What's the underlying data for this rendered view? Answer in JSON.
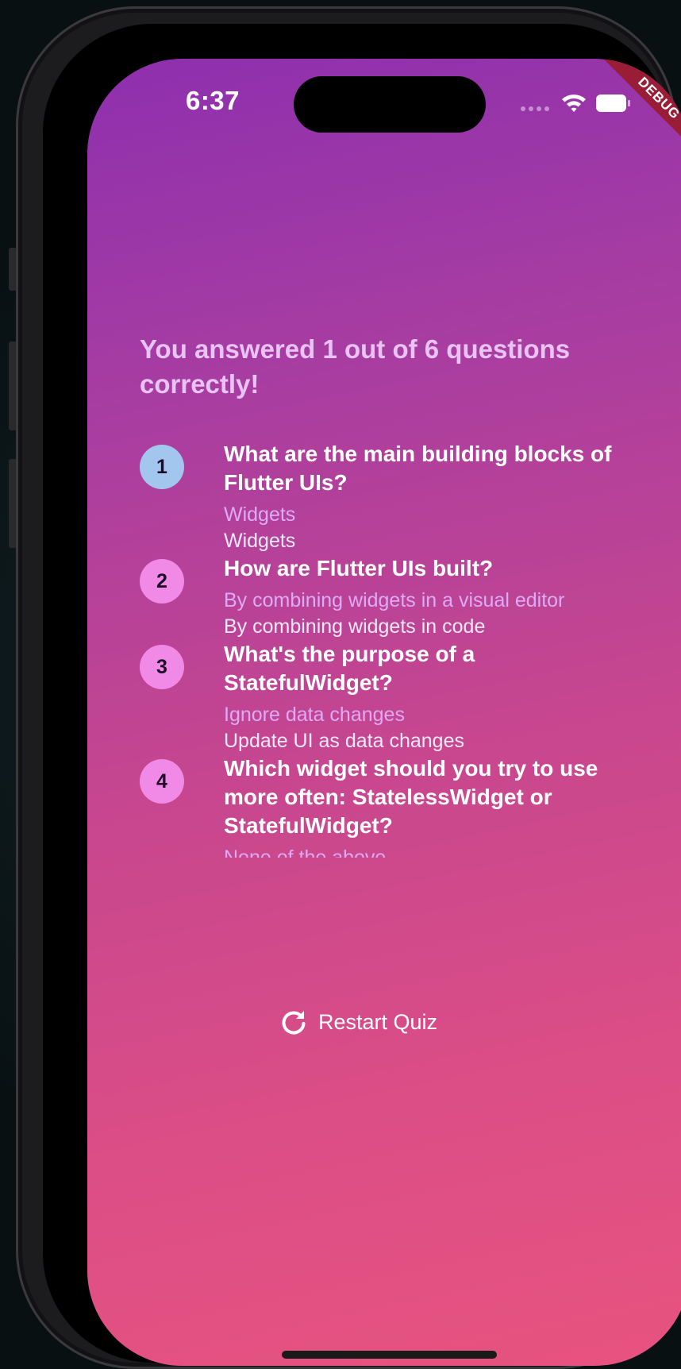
{
  "status_bar": {
    "time": "6:37",
    "icons": [
      "cellular-dots-icon",
      "wifi-icon",
      "battery-icon"
    ]
  },
  "debug_banner": "DEBUG",
  "results": {
    "title": "You answered 1 out of 6 questions correctly!",
    "items": [
      {
        "number": "1",
        "question": "What are the main building blocks of Flutter UIs?",
        "user_answer": "Widgets",
        "correct_answer": "Widgets",
        "is_correct": true
      },
      {
        "number": "2",
        "question": "How are Flutter UIs built?",
        "user_answer": "By combining widgets in a visual editor",
        "correct_answer": "By combining widgets in code",
        "is_correct": false
      },
      {
        "number": "3",
        "question": "What's the purpose of a StatefulWidget?",
        "user_answer": "Ignore data changes",
        "correct_answer": "Update UI as data changes",
        "is_correct": false
      },
      {
        "number": "4",
        "question": "Which widget should you try to use more often: StatelessWidget or StatefulWidget?",
        "user_answer": "None of the above",
        "correct_answer": "",
        "is_correct": false
      }
    ]
  },
  "restart_button": {
    "label": "Restart Quiz",
    "icon": "refresh-icon"
  },
  "colors": {
    "gradient_start": "#8e2fae",
    "gradient_end": "#e8537f",
    "correct_badge": "#a3c6ef",
    "incorrect_badge": "#f08ae6",
    "title_text": "#e9c3f4",
    "user_answer_text": "#ddaaf6",
    "debug_banner": "#9a1d37"
  }
}
